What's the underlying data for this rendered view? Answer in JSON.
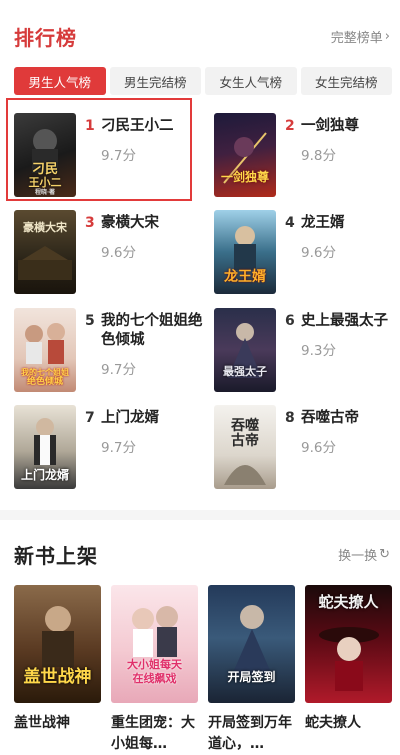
{
  "ranking": {
    "title": "排行榜",
    "full_list_label": "完整榜单",
    "tabs": [
      "男生人气榜",
      "男生完结榜",
      "女生人气榜",
      "女生完结榜"
    ],
    "active_tab": 0,
    "books": [
      {
        "rank": "1",
        "title": "刁民王小二",
        "score": "9.7分",
        "cover_text": "刁民王小二",
        "cover_sub": "程晓·著"
      },
      {
        "rank": "2",
        "title": "一剑独尊",
        "score": "9.8分",
        "cover_text": "一剑独尊"
      },
      {
        "rank": "3",
        "title": "豪横大宋",
        "score": "9.6分",
        "cover_text": "豪横大宋"
      },
      {
        "rank": "4",
        "title": "龙王婿",
        "score": "9.6分",
        "cover_text": "龙王婿"
      },
      {
        "rank": "5",
        "title": "我的七个姐姐绝色倾城",
        "score": "9.7分",
        "cover_text": "我的七个姐姐绝色倾城"
      },
      {
        "rank": "6",
        "title": "史上最强太子",
        "score": "9.3分",
        "cover_text": "最强太子"
      },
      {
        "rank": "7",
        "title": "上门龙婿",
        "score": "9.7分",
        "cover_text": "上门龙婿"
      },
      {
        "rank": "8",
        "title": "吞噬古帝",
        "score": "9.6分",
        "cover_text": "吞噬古帝"
      }
    ]
  },
  "new_books": {
    "title": "新书上架",
    "refresh_label": "换一换",
    "books": [
      {
        "title": "盖世战神",
        "cover_text": "盖世战神"
      },
      {
        "title": "重生团宠：大小姐每天在线飙戏",
        "display_title": "重生团宠：大小姐每…",
        "cover_text": "大小姐每天在线飙戏"
      },
      {
        "title": "开局签到万年道心，",
        "display_title": "开局签到万年道心，…",
        "cover_text": "开局签到万年道心"
      },
      {
        "title": "蛇夫撩人",
        "cover_text": "蛇夫撩人"
      }
    ]
  },
  "colors": {
    "accent": "#d63b3b",
    "tab_active_bg": "#e03a3a",
    "tab_bg": "#f2f2f2",
    "muted": "#999999"
  }
}
